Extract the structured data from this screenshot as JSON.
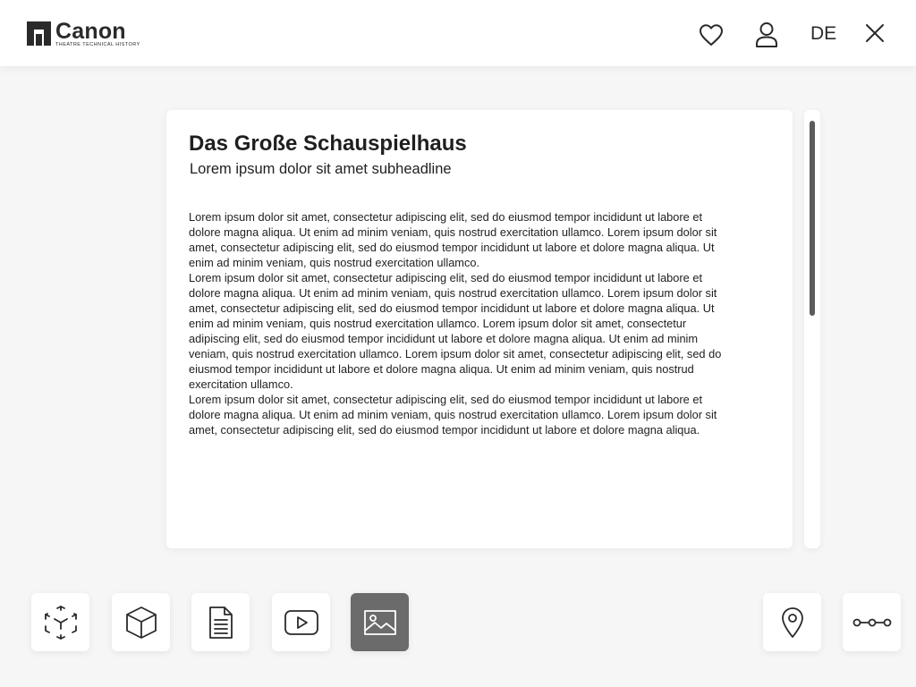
{
  "header": {
    "logo": {
      "name": "Canon",
      "tagline": "THEATRE TECHNICAL HISTORY"
    },
    "icons": [
      "heart-icon",
      "user-icon",
      "close-icon"
    ],
    "language": "DE"
  },
  "article": {
    "title": "Das Große Schauspielhaus",
    "subtitle": "Lorem ipsum dolor sit amet subheadline",
    "paragraphs": [
      "Lorem ipsum dolor sit amet, consectetur adipiscing elit, sed do eiusmod tempor incididunt ut labore et dolore magna aliqua. Ut enim ad minim veniam, quis nostrud exercitation ullamco. Lorem ipsum dolor sit amet, consectetur adipiscing elit, sed do eiusmod tempor incididunt ut labore et dolore magna aliqua. Ut enim ad minim veniam, quis nostrud exercitation ullamco.",
      "Lorem ipsum dolor sit amet, consectetur adipiscing elit, sed do eiusmod tempor incididunt ut labore et dolore magna aliqua. Ut enim ad minim veniam, quis nostrud exercitation ullamco. Lorem ipsum dolor sit amet, consectetur adipiscing elit, sed do eiusmod tempor incididunt ut labore et dolore magna aliqua. Ut enim ad minim veniam, quis nostrud exercitation ullamco. Lorem ipsum dolor sit amet, consectetur adipiscing elit, sed do eiusmod tempor incididunt ut labore et dolore magna aliqua. Ut enim ad minim veniam, quis nostrud exercitation ullamco. Lorem ipsum dolor sit amet, consectetur adipiscing elit, sed do eiusmod tempor incididunt ut labore et dolore magna aliqua. Ut enim ad minim veniam, quis nostrud exercitation ullamco.",
      "Lorem ipsum dolor sit amet, consectetur adipiscing elit, sed do eiusmod tempor incididunt ut labore et dolore magna aliqua. Ut enim ad minim veniam, quis nostrud exercitation ullamco. Lorem ipsum dolor sit amet, consectetur adipiscing elit, sed do eiusmod tempor incididunt ut labore et dolore magna aliqua."
    ]
  },
  "toolbar": {
    "left": [
      "ar-cube-icon",
      "3d-model-icon",
      "document-icon",
      "video-icon",
      "image-icon"
    ],
    "active": "image-icon",
    "right": [
      "location-pin-icon",
      "timeline-icon"
    ]
  },
  "colors": {
    "background": "#f6f6f7",
    "surface": "#ffffff",
    "text": "#1f1f1f",
    "active_tool": "#6b6b6b",
    "scroll_thumb": "#5b5b5b"
  }
}
